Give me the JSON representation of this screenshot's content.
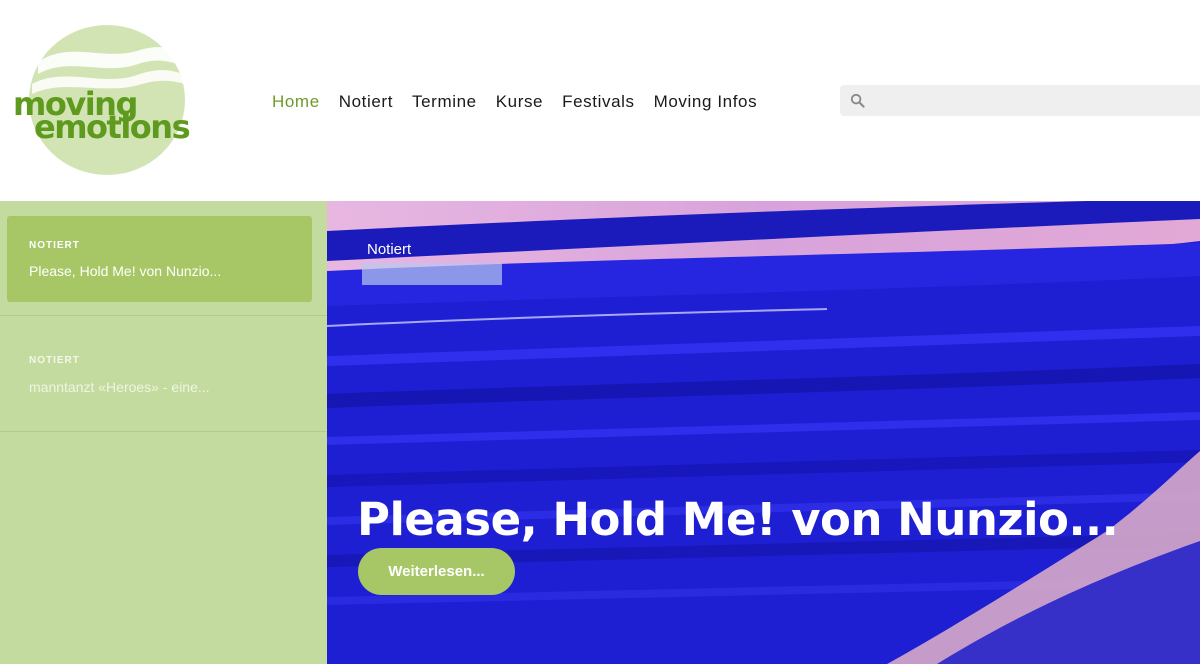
{
  "colors": {
    "accent_green": "#a7c766",
    "nav_active": "#6f9a2a",
    "sidebar_bg": "#c4dba0",
    "hero_blue": "#1f1fd6"
  },
  "logo": {
    "line1": "moving",
    "line2": "emotions",
    "icon": "moving-emotions-logo"
  },
  "nav": {
    "items": [
      {
        "label": "Home",
        "active": true
      },
      {
        "label": "Notiert",
        "active": false
      },
      {
        "label": "Termine",
        "active": false
      },
      {
        "label": "Kurse",
        "active": false
      },
      {
        "label": "Festivals",
        "active": false
      },
      {
        "label": "Moving Infos",
        "active": false
      }
    ]
  },
  "search": {
    "icon": "search-icon",
    "placeholder": "",
    "value": ""
  },
  "sidebar": {
    "items": [
      {
        "category": "NOTIERT",
        "title": "Please, Hold Me! von Nunzio...",
        "active": true
      },
      {
        "category": "NOTIERT",
        "title": "manntanzt «Heroes» - eine...",
        "active": false
      }
    ]
  },
  "hero": {
    "category": "Notiert",
    "title": "Please, Hold Me! von Nunzio...",
    "button_label": "Weiterlesen..."
  }
}
